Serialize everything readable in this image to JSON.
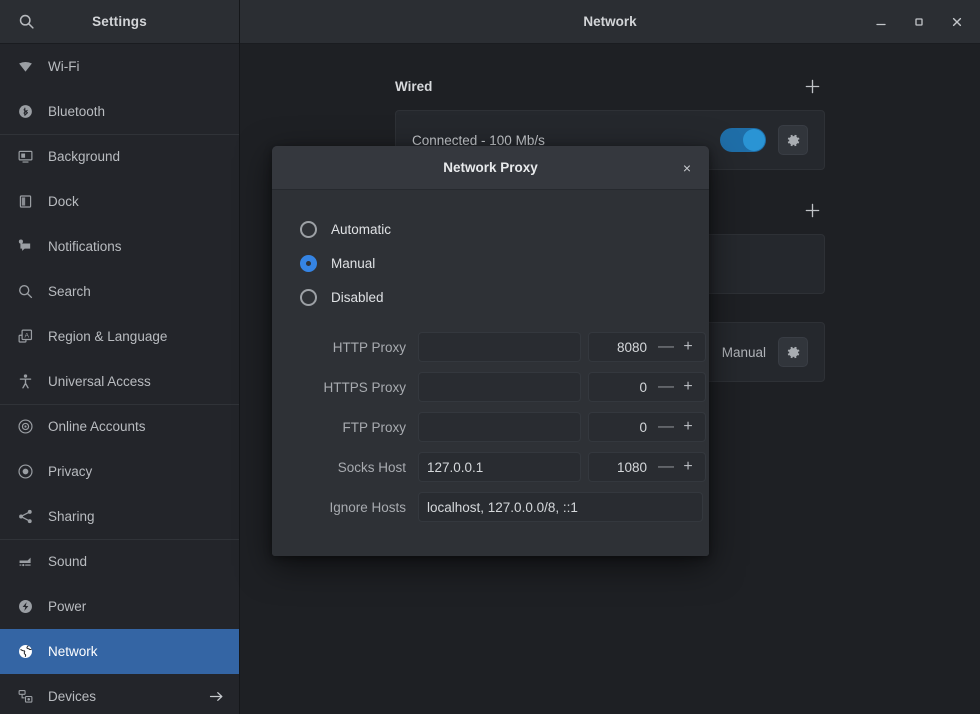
{
  "sidebar": {
    "title": "Settings",
    "search_icon": "search-icon",
    "items": [
      {
        "label": "Wi-Fi",
        "icon": "wifi-icon",
        "sep": false,
        "selected": false,
        "trail": ""
      },
      {
        "label": "Bluetooth",
        "icon": "bluetooth-icon",
        "sep": false,
        "selected": false,
        "trail": ""
      },
      {
        "label": "Background",
        "icon": "background-icon",
        "sep": true,
        "selected": false,
        "trail": ""
      },
      {
        "label": "Dock",
        "icon": "dock-icon",
        "sep": false,
        "selected": false,
        "trail": ""
      },
      {
        "label": "Notifications",
        "icon": "notifications-icon",
        "sep": false,
        "selected": false,
        "trail": ""
      },
      {
        "label": "Search",
        "icon": "search-icon",
        "sep": false,
        "selected": false,
        "trail": ""
      },
      {
        "label": "Region & Language",
        "icon": "region-language-icon",
        "sep": false,
        "selected": false,
        "trail": ""
      },
      {
        "label": "Universal Access",
        "icon": "universal-access-icon",
        "sep": false,
        "selected": false,
        "trail": ""
      },
      {
        "label": "Online Accounts",
        "icon": "online-accounts-icon",
        "sep": true,
        "selected": false,
        "trail": ""
      },
      {
        "label": "Privacy",
        "icon": "privacy-icon",
        "sep": false,
        "selected": false,
        "trail": ""
      },
      {
        "label": "Sharing",
        "icon": "sharing-icon",
        "sep": false,
        "selected": false,
        "trail": ""
      },
      {
        "label": "Sound",
        "icon": "sound-icon",
        "sep": true,
        "selected": false,
        "trail": ""
      },
      {
        "label": "Power",
        "icon": "power-icon",
        "sep": false,
        "selected": false,
        "trail": ""
      },
      {
        "label": "Network",
        "icon": "network-icon",
        "sep": false,
        "selected": true,
        "trail": ""
      },
      {
        "label": "Devices",
        "icon": "devices-icon",
        "sep": false,
        "selected": false,
        "trail": "arrow-right-icon"
      }
    ]
  },
  "titlebar": {
    "title": "Network",
    "minimize_label": "minimize-icon",
    "maximize_label": "maximize-icon",
    "close_label": "close-icon"
  },
  "main": {
    "sections": [
      {
        "title": "Wired",
        "add_label": "+",
        "row_label": "Connected - 100 Mb/s",
        "row_value": "",
        "has_toggle": true,
        "has_gear": true
      },
      {
        "title": "",
        "add_label": "+",
        "row_label": "",
        "row_value": "",
        "has_toggle": false,
        "has_gear": false
      },
      {
        "title": "",
        "add_label": "",
        "row_label": "",
        "row_value": "Manual",
        "has_toggle": false,
        "has_gear": true
      }
    ]
  },
  "dialog": {
    "title": "Network Proxy",
    "close_label": "×",
    "radios": [
      {
        "label": "Automatic",
        "checked": false
      },
      {
        "label": "Manual",
        "checked": true
      },
      {
        "label": "Disabled",
        "checked": false
      }
    ],
    "fields": [
      {
        "label": "HTTP Proxy",
        "value": "",
        "port": "8080",
        "type": "host-port"
      },
      {
        "label": "HTTPS Proxy",
        "value": "",
        "port": "0",
        "type": "host-port"
      },
      {
        "label": "FTP Proxy",
        "value": "",
        "port": "0",
        "type": "host-port"
      },
      {
        "label": "Socks Host",
        "value": "127.0.0.1",
        "port": "1080",
        "type": "host-port"
      },
      {
        "label": "Ignore Hosts",
        "value": "localhost, 127.0.0.0/8, ::1",
        "port": "",
        "type": "wide"
      }
    ],
    "spin_minus": "—",
    "spin_plus": "+"
  },
  "colors": {
    "accent_selection": "#3465a4",
    "accent_radio": "#3584e4",
    "toggle_on": "#1f6ea8",
    "toggle_knob": "#2a94d4",
    "sidebar_bg": "#23252a",
    "main_bg": "#1e2024",
    "dialog_bg": "#2e3136"
  }
}
